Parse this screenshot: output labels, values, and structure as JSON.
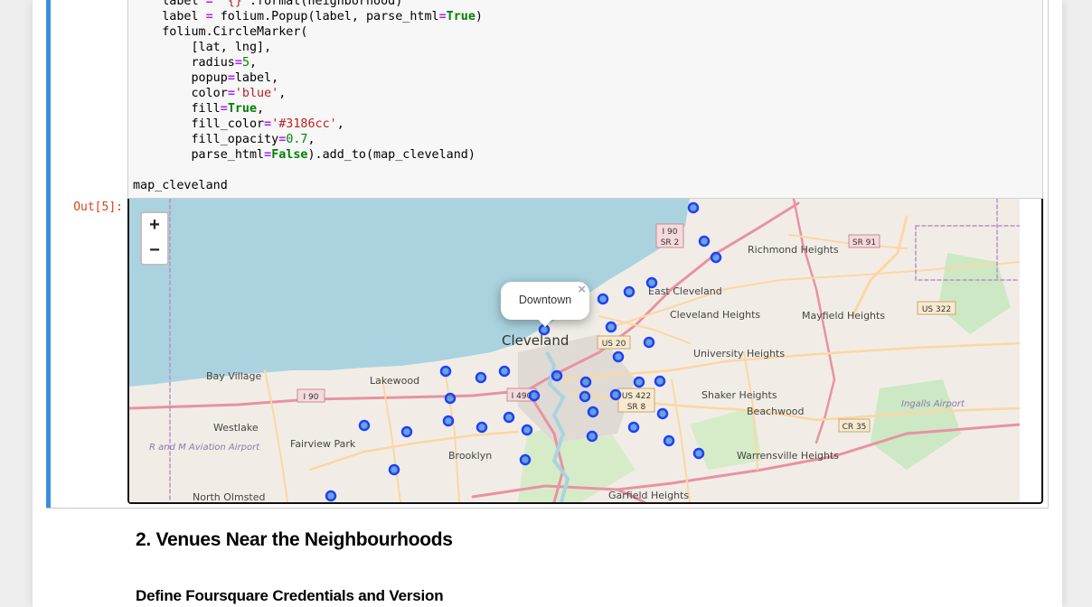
{
  "code": {
    "lines": [
      [
        {
          "t": "    label "
        },
        {
          "t": "=",
          "c": "op"
        },
        {
          "t": " "
        },
        {
          "t": "'{}'",
          "c": "str"
        },
        {
          "t": ".format(neighborhood)"
        }
      ],
      [
        {
          "t": "    label "
        },
        {
          "t": "=",
          "c": "op"
        },
        {
          "t": " folium.Popup(label, parse_html"
        },
        {
          "t": "=",
          "c": "op"
        },
        {
          "t": "True",
          "c": "kw"
        },
        {
          "t": ")"
        }
      ],
      [
        {
          "t": "    folium.CircleMarker("
        }
      ],
      [
        {
          "t": "        [lat, lng],"
        }
      ],
      [
        {
          "t": "        radius"
        },
        {
          "t": "=",
          "c": "op"
        },
        {
          "t": "5",
          "c": "num"
        },
        {
          "t": ","
        }
      ],
      [
        {
          "t": "        popup"
        },
        {
          "t": "=",
          "c": "op"
        },
        {
          "t": "label,"
        }
      ],
      [
        {
          "t": "        color"
        },
        {
          "t": "=",
          "c": "op"
        },
        {
          "t": "'blue'",
          "c": "str"
        },
        {
          "t": ","
        }
      ],
      [
        {
          "t": "        fill"
        },
        {
          "t": "=",
          "c": "op"
        },
        {
          "t": "True",
          "c": "kw"
        },
        {
          "t": ","
        }
      ],
      [
        {
          "t": "        fill_color"
        },
        {
          "t": "=",
          "c": "op"
        },
        {
          "t": "'#3186cc'",
          "c": "str"
        },
        {
          "t": ","
        }
      ],
      [
        {
          "t": "        fill_opacity"
        },
        {
          "t": "=",
          "c": "op"
        },
        {
          "t": "0.7",
          "c": "num"
        },
        {
          "t": ","
        }
      ],
      [
        {
          "t": "        parse_html"
        },
        {
          "t": "=",
          "c": "op"
        },
        {
          "t": "False",
          "c": "kw"
        },
        {
          "t": ").add_to(map_cleveland)"
        }
      ],
      [
        {
          "t": ""
        }
      ],
      [
        {
          "t": "map_cleveland"
        }
      ]
    ]
  },
  "output": {
    "prompt": "Out[5]:"
  },
  "map": {
    "zoom_in": "+",
    "zoom_out": "−",
    "popup_text": "Downtown",
    "popup_close": "×",
    "marker_color": "#3186cc",
    "marker_stroke": "#1f3fff",
    "water_color": "#aad3df",
    "land_color": "#f1ede6",
    "labels": {
      "cleveland": "Cleveland",
      "bay_village": "Bay Village",
      "lakewood": "Lakewood",
      "westlake": "Westlake",
      "fairview_park": "Fairview Park",
      "brooklyn": "Brooklyn",
      "north_olmsted": "North Olmsted",
      "east_cleveland": "East Cleveland",
      "cleveland_heights": "Cleveland Heights",
      "university_heights": "University Heights",
      "shaker_heights": "Shaker Heights",
      "beachwood": "Beachwood",
      "warrensville_heights": "Warrensville Heights",
      "garfield_heights": "Garfield Heights",
      "richmond_heights": "Richmond Heights",
      "mayfield_heights": "Mayfield Heights",
      "ingalls_airport": "Ingalls Airport",
      "rm_airport": "R and M Aviation Airport",
      "shields": [
        "I 90 SR 2",
        "SR 91",
        "US 322",
        "US 20",
        "US 422 SR 8",
        "I 90",
        "I 490",
        "CR 35"
      ]
    }
  },
  "sections": {
    "venues_heading": "2. Venues Near the Neighbourhoods",
    "credentials_heading": "Define Foursquare Credentials and Version"
  }
}
